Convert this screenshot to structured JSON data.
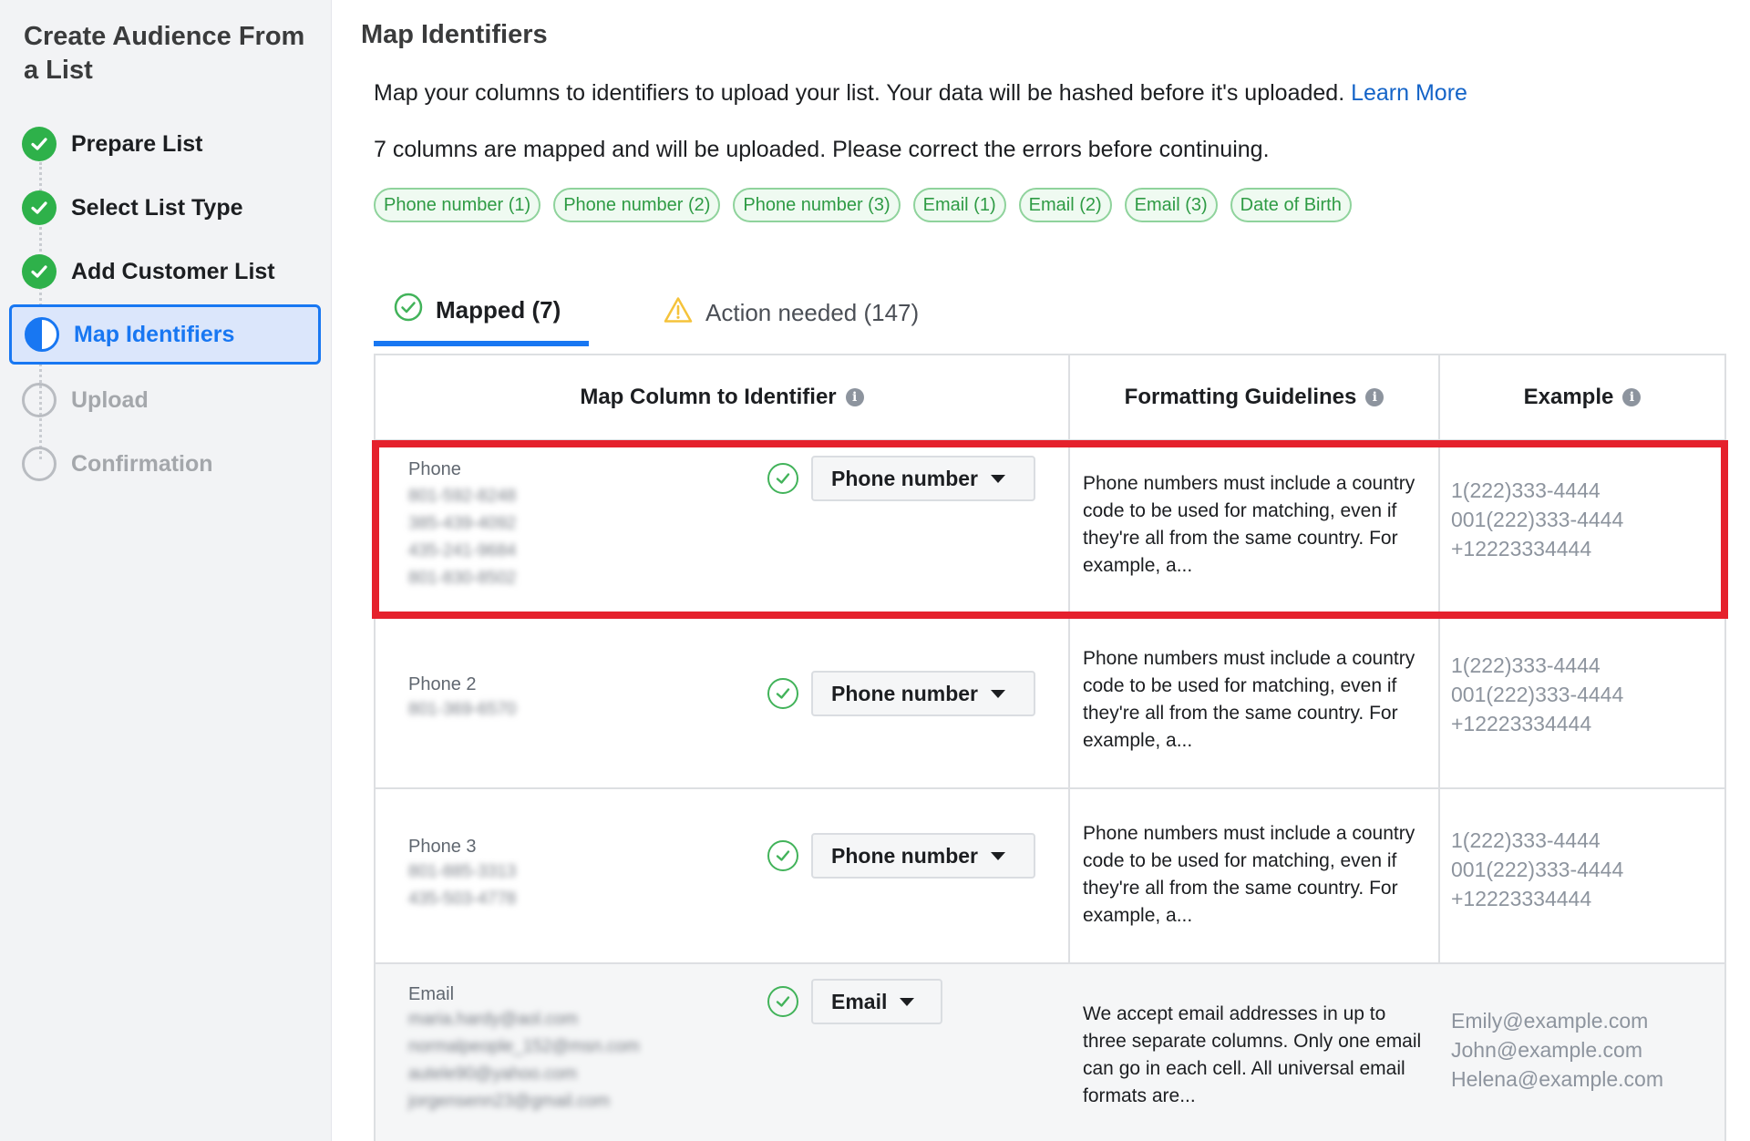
{
  "sidebar": {
    "title": "Create Audience From a List",
    "steps": [
      {
        "label": "Prepare List",
        "state": "done"
      },
      {
        "label": "Select List Type",
        "state": "done"
      },
      {
        "label": "Add Customer List",
        "state": "done"
      },
      {
        "label": "Map Identifiers",
        "state": "active"
      },
      {
        "label": "Upload",
        "state": "pending"
      },
      {
        "label": "Confirmation",
        "state": "pending"
      }
    ]
  },
  "main": {
    "title": "Map Identifiers",
    "intro": "Map your columns to identifiers to upload your list. Your data will be hashed before it's uploaded.",
    "learn_more": "Learn More",
    "status": "7 columns are mapped and will be uploaded. Please correct the errors before continuing.",
    "chips": [
      "Phone number (1)",
      "Phone number (2)",
      "Phone number (3)",
      "Email (1)",
      "Email (2)",
      "Email (3)",
      "Date of Birth"
    ],
    "tabs": {
      "mapped": "Mapped (7)",
      "action_needed": "Action needed (147)"
    }
  },
  "table": {
    "headers": {
      "map_column": "Map Column to Identifier",
      "formatting": "Formatting Guidelines",
      "example": "Example"
    },
    "rows": [
      {
        "column": "Phone",
        "samples": [
          "801-592-8248",
          "385-439-4092",
          "435-241-9684",
          "801-830-8502"
        ],
        "identifier": "Phone number",
        "guideline": "Phone numbers must include a country code to be used for matching, even if they're all from the same country. For example, a...",
        "examples": [
          "1(222)333-4444",
          "001(222)333-4444",
          "+12223334444"
        ]
      },
      {
        "column": "Phone 2",
        "samples": [
          "801-369-6570"
        ],
        "identifier": "Phone number",
        "guideline": "Phone numbers must include a country code to be used for matching, even if they're all from the same country. For example, a...",
        "examples": [
          "1(222)333-4444",
          "001(222)333-4444",
          "+12223334444"
        ]
      },
      {
        "column": "Phone 3",
        "samples": [
          "801-885-3313",
          "435-503-4778"
        ],
        "identifier": "Phone number",
        "guideline": "Phone numbers must include a country code to be used for matching, even if they're all from the same country. For example, a...",
        "examples": [
          "1(222)333-4444",
          "001(222)333-4444",
          "+12223334444"
        ]
      },
      {
        "column": "Email",
        "samples": [
          "maria.hardy@aol.com",
          "normalpeople_152@msn.com",
          "autele90@yahoo.com",
          "jorgensenn23@gmail.com"
        ],
        "identifier": "Email",
        "guideline": "We accept email addresses in up to three separate columns. Only one email can go in each cell. All universal email formats are...",
        "examples": [
          "Emily@example.com",
          "John@example.com",
          "Helena@example.com"
        ]
      }
    ]
  },
  "colors": {
    "accent": "#1877f2",
    "success": "#42b35a",
    "warning": "#f5c33b",
    "highlight": "#e5212c"
  }
}
